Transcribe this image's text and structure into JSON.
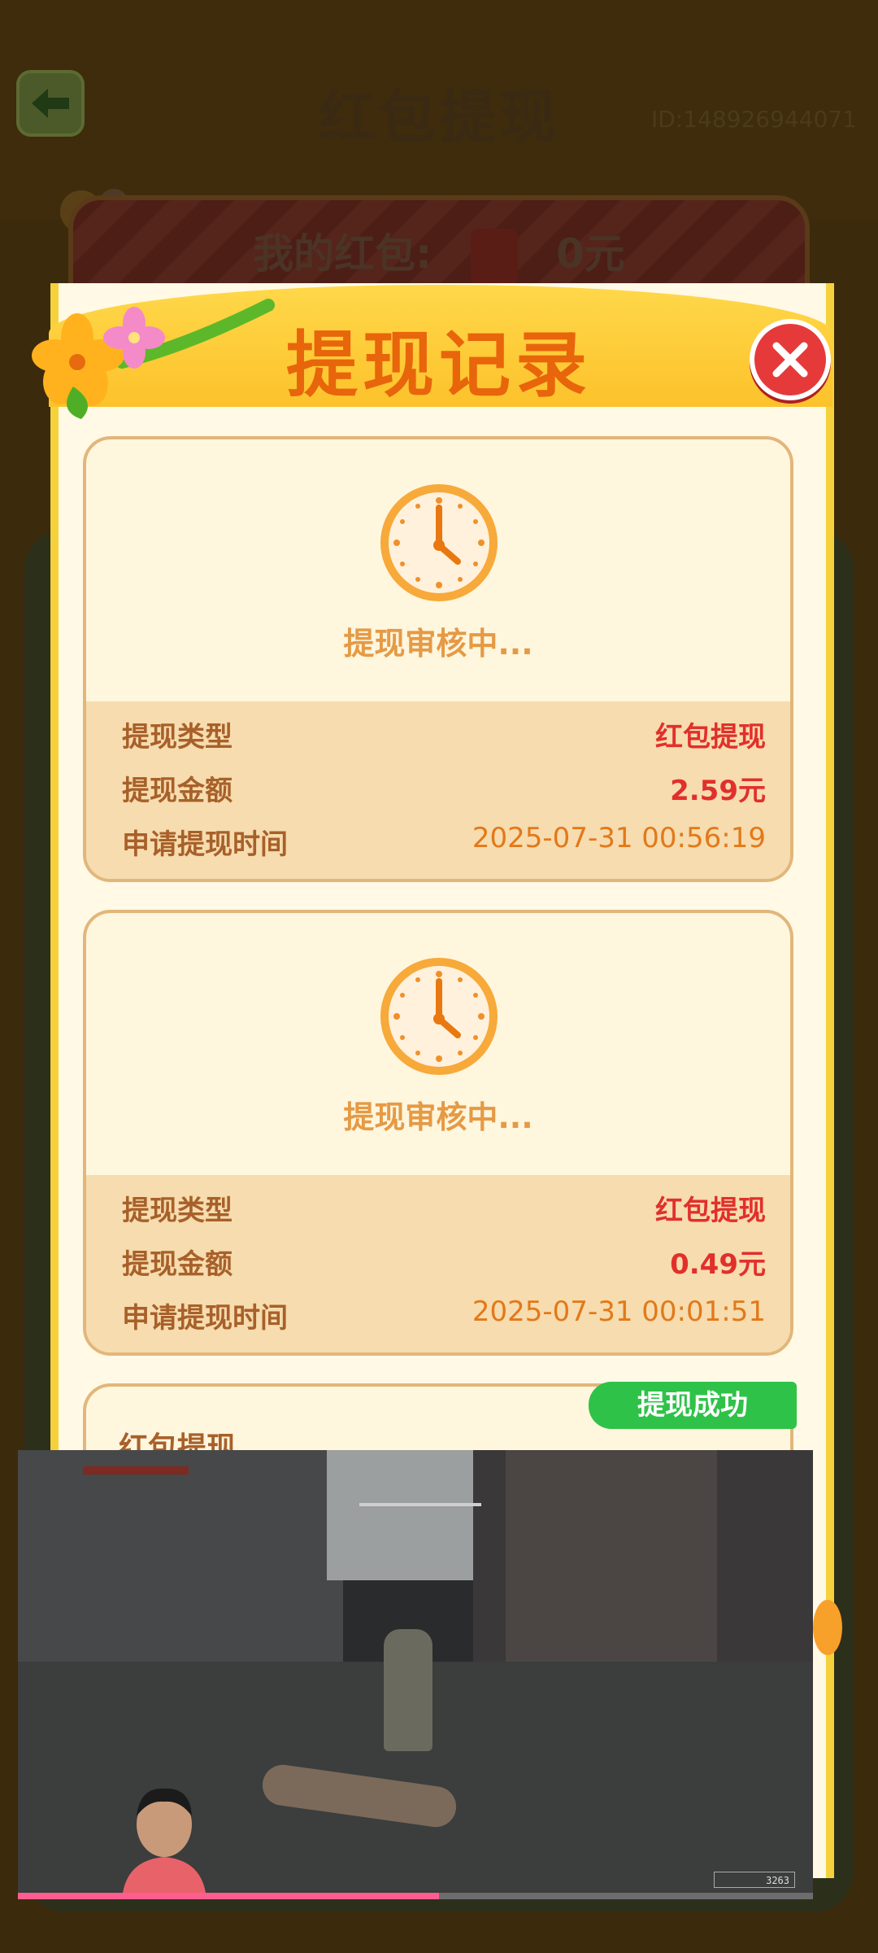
{
  "background_page": {
    "title": "红包提现",
    "user_id": "ID:148926944071",
    "wallet_label": "我的红包:",
    "wallet_amount": "0元"
  },
  "modal": {
    "title": "提现记录",
    "records": [
      {
        "status": "提现审核中...",
        "type_label": "提现类型",
        "type_value": "红包提现",
        "amount_label": "提现金额",
        "amount_value": "2.59元",
        "time_label": "申请提现时间",
        "time_value": "2025-07-31 00:56:19"
      },
      {
        "status": "提现审核中...",
        "type_label": "提现类型",
        "type_value": "红包提现",
        "amount_label": "提现金额",
        "amount_value": "0.49元",
        "time_label": "申请提现时间",
        "time_value": "2025-07-31 00:01:51"
      }
    ],
    "partial_record": {
      "title": "红包提现",
      "badge": "提现成功"
    }
  },
  "video_overlay": {
    "counter": "3263",
    "progress_fraction": 0.53
  },
  "colors": {
    "accent_orange": "#e8650b",
    "amount_red": "#e1302c",
    "success_green": "#2fc248",
    "close_red": "#e63a3a"
  },
  "icons": [
    "back-arrow-icon",
    "red-packet-icon",
    "close-icon",
    "clock-icon",
    "flower-icon"
  ]
}
